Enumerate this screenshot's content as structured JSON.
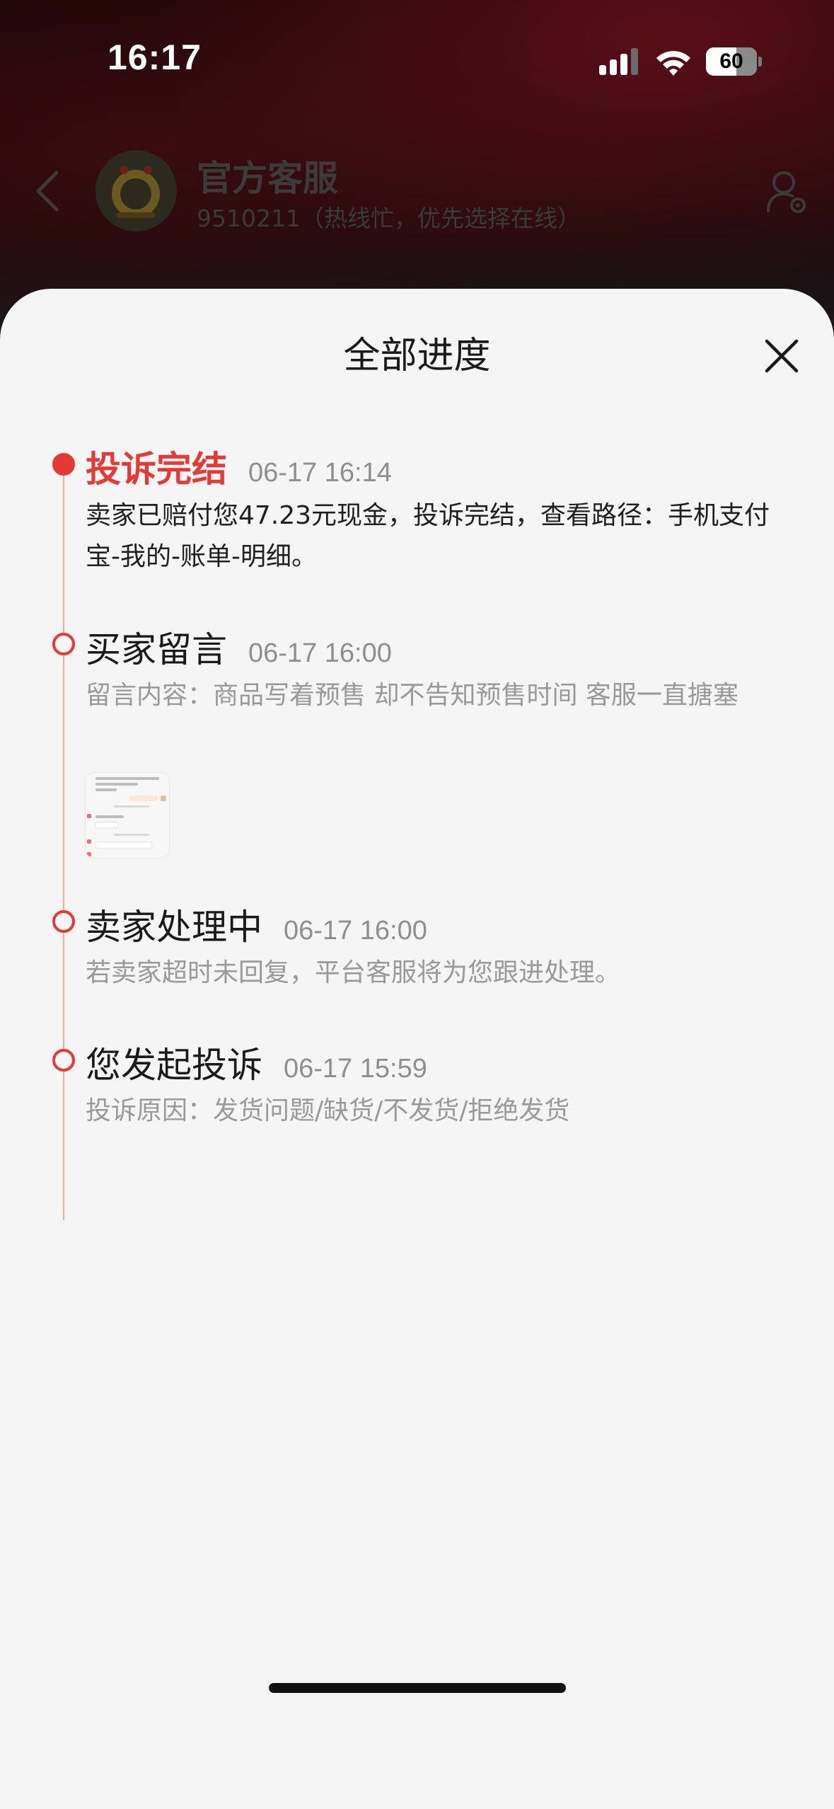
{
  "status_bar": {
    "time": "16:17",
    "battery": "60",
    "battery_level": 0.6
  },
  "chat_header": {
    "title": "官方客服",
    "subtitle": "9510211（热线忙，优先选择在线）"
  },
  "sheet": {
    "title": "全部进度",
    "close_icon": "close-icon"
  },
  "timeline": [
    {
      "title": "投诉完结",
      "time": "06-17 16:14",
      "description": "卖家已赔付您47.23元现金，投诉完结，查看路径：手机支付宝-我的-账单-明细。",
      "active": true
    },
    {
      "title": "买家留言",
      "time": "06-17 16:00",
      "description": "留言内容：商品写着预售 却不告知预售时间 客服一直搪塞",
      "has_image": true
    },
    {
      "title": "卖家处理中",
      "time": "06-17 16:00",
      "description": "若卖家超时未回复，平台客服将为您跟进处理。"
    },
    {
      "title": "您发起投诉",
      "time": "06-17 15:59",
      "description": "投诉原因：发货问题/缺货/不发货/拒绝发货"
    }
  ],
  "colors": {
    "accent_red": "#e53935",
    "timeline_line": "#f0a99a",
    "sheet_bg": "#f5f5f5"
  }
}
